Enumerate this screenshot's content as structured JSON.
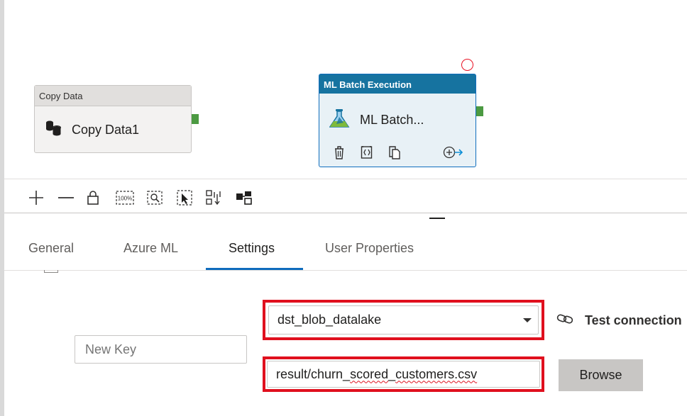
{
  "canvas": {
    "activities": [
      {
        "type_label": "Copy Data",
        "name": "Copy Data1",
        "icon": "database-icon"
      },
      {
        "type_label": "ML Batch Execution",
        "name": "ML Batch...",
        "icon": "flask-icon",
        "actions": [
          "delete-icon",
          "code-icon",
          "copy-icon",
          "add-output-icon"
        ]
      }
    ]
  },
  "toolbar": {
    "buttons": [
      "zoom-in-icon",
      "zoom-out-icon",
      "lock-icon",
      "zoom-100-icon",
      "zoom-to-fit-icon",
      "select-icon",
      "auto-align-icon",
      "layout-icon"
    ],
    "zoom_100_label": "100%"
  },
  "tabs": [
    {
      "label": "General",
      "selected": false
    },
    {
      "label": "Azure ML",
      "selected": false
    },
    {
      "label": "Settings",
      "selected": true
    },
    {
      "label": "User Properties",
      "selected": false
    }
  ],
  "settings": {
    "new_key_placeholder": "New Key",
    "linked_service_value": "dst_blob_datalake",
    "test_connection_label": "Test connection",
    "file_path_prefix": "result/churn_",
    "file_path_misspelled": "scored",
    "file_path_mid": "_",
    "file_path_misspelled2": "customers.csv",
    "browse_label": "Browse"
  },
  "colors": {
    "accent": "#0f6cbd",
    "ml_header": "#1673a0",
    "port": "#4c9a42",
    "highlight": "#e0101e"
  }
}
